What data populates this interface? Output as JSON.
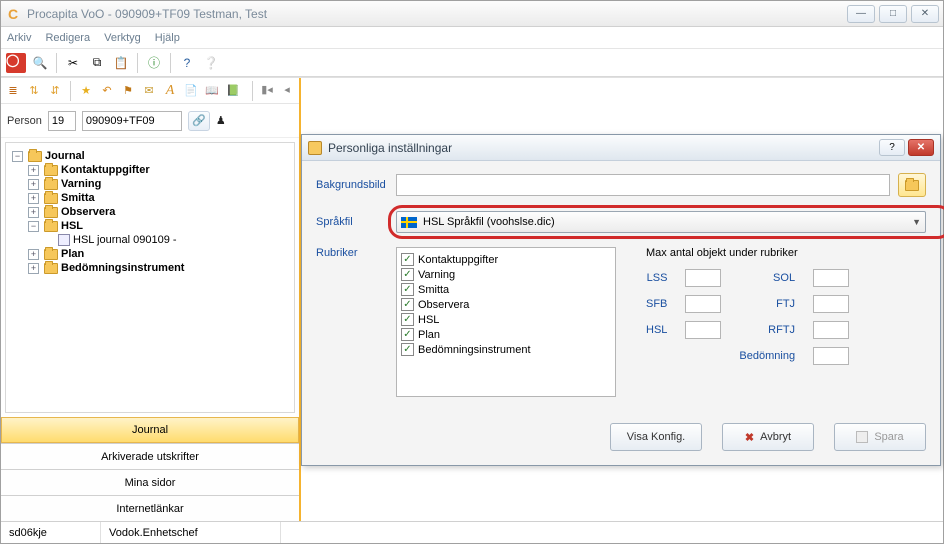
{
  "window": {
    "title": "Procapita VoO - 090909+TF09 Testman, Test",
    "icon_letter": "C"
  },
  "menu": {
    "items": [
      "Arkiv",
      "Redigera",
      "Verktyg",
      "Hjälp"
    ]
  },
  "person": {
    "label": "Person",
    "id": "19",
    "pnr": "090909+TF09"
  },
  "tree": {
    "root": "Journal",
    "items": [
      {
        "label": "Kontaktuppgifter",
        "bold": true
      },
      {
        "label": "Varning",
        "bold": true
      },
      {
        "label": "Smitta",
        "bold": true
      },
      {
        "label": "Observera",
        "bold": true
      },
      {
        "label": "HSL",
        "bold": true,
        "children": [
          {
            "label": "HSL journal 090109 -"
          }
        ]
      },
      {
        "label": "Plan",
        "bold": true
      },
      {
        "label": "Bedömningsinstrument",
        "bold": true
      }
    ]
  },
  "bottom_tabs": [
    "Journal",
    "Arkiverade utskrifter",
    "Mina sidor",
    "Internetlänkar"
  ],
  "status": {
    "user": "sd06kje",
    "role": "Vodok.Enhetschef"
  },
  "dialog": {
    "title": "Personliga inställningar",
    "bakgrund_label": "Bakgrundsbild",
    "bakgrund_value": "",
    "sprakfil_label": "Språkfil",
    "sprakfil_value": "HSL Språkfil  (voohslse.dic)",
    "rubriker_label": "Rubriker",
    "rubriker": [
      {
        "label": "Kontaktuppgifter",
        "checked": true
      },
      {
        "label": "Varning",
        "checked": true
      },
      {
        "label": "Smitta",
        "checked": true
      },
      {
        "label": "Observera",
        "checked": true
      },
      {
        "label": "HSL",
        "checked": true
      },
      {
        "label": "Plan",
        "checked": true
      },
      {
        "label": "Bedömningsinstrument",
        "checked": true
      }
    ],
    "max_title": "Max antal objekt under rubriker",
    "max_fields": {
      "LSS": "",
      "SOL": "",
      "SFB": "",
      "FTJ": "",
      "HSL": "",
      "RFTJ": "",
      "Bedomning_label": "Bedömning",
      "Bedomning": ""
    },
    "buttons": {
      "visa": "Visa Konfig.",
      "avbryt": "Avbryt",
      "spara": "Spara"
    }
  }
}
